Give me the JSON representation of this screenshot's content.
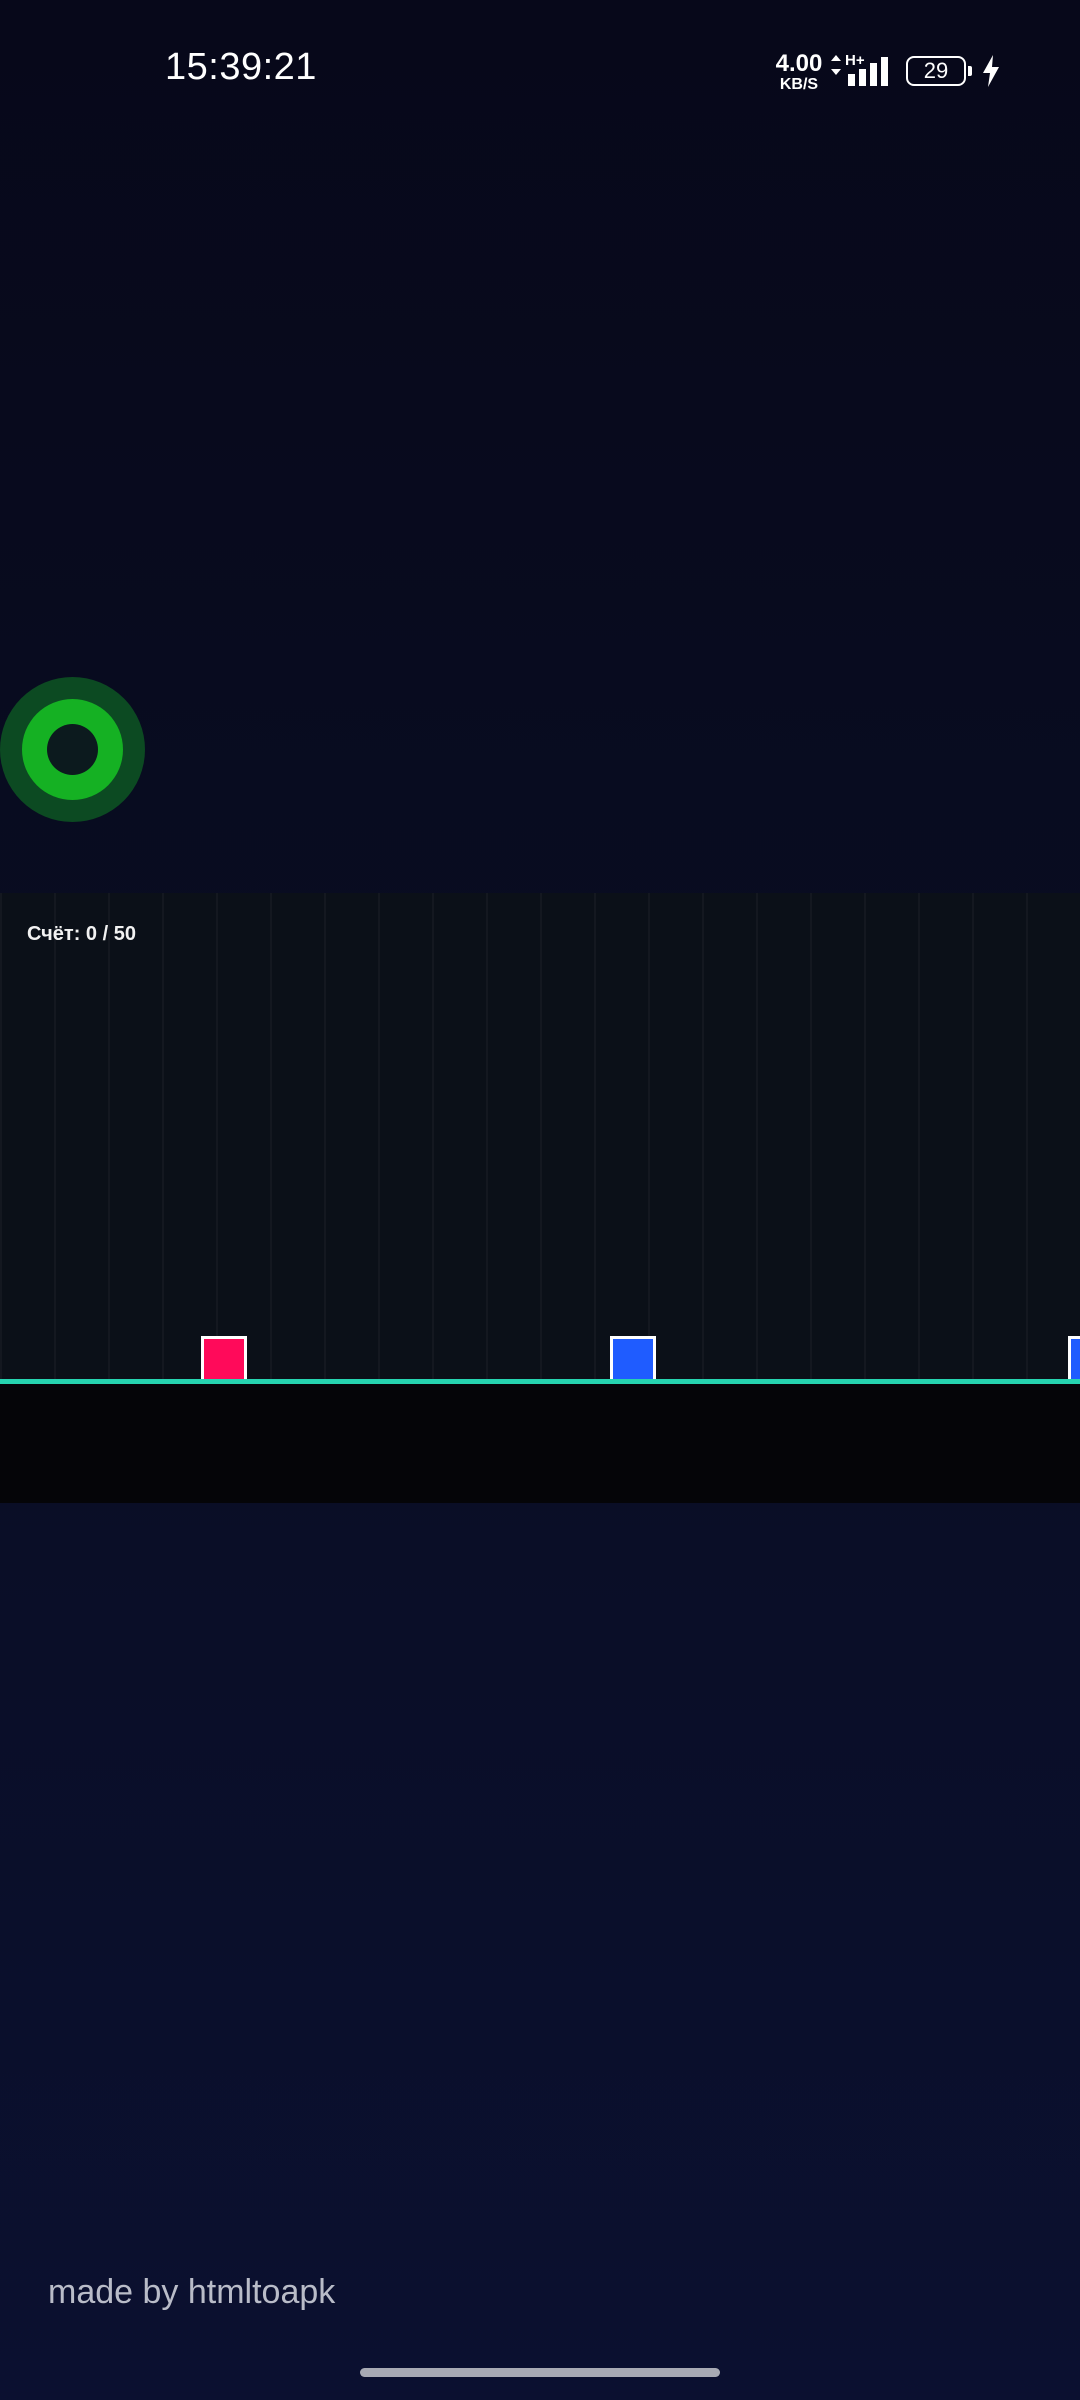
{
  "status_bar": {
    "time": "15:39:21",
    "net_speed_value": "4.00",
    "net_speed_unit": "KB/S",
    "network_type": "H+",
    "battery_level": "29",
    "icons": [
      "data-transfer-arrows-icon",
      "signal-strength-icon",
      "battery-icon",
      "charging-bolt-icon"
    ]
  },
  "game": {
    "score_text": "Счёт: 0 / 50",
    "colors": {
      "background": "#0b1018",
      "ground_line": "#26d4b0",
      "floor": "#050508",
      "player_block": "#ff0a5a",
      "obstacle_block": "#1f5cff",
      "joystick_outer": "#0c4a22",
      "joystick_ring": "#15b123"
    }
  },
  "footer": {
    "credit": "made by htmltoapk"
  }
}
